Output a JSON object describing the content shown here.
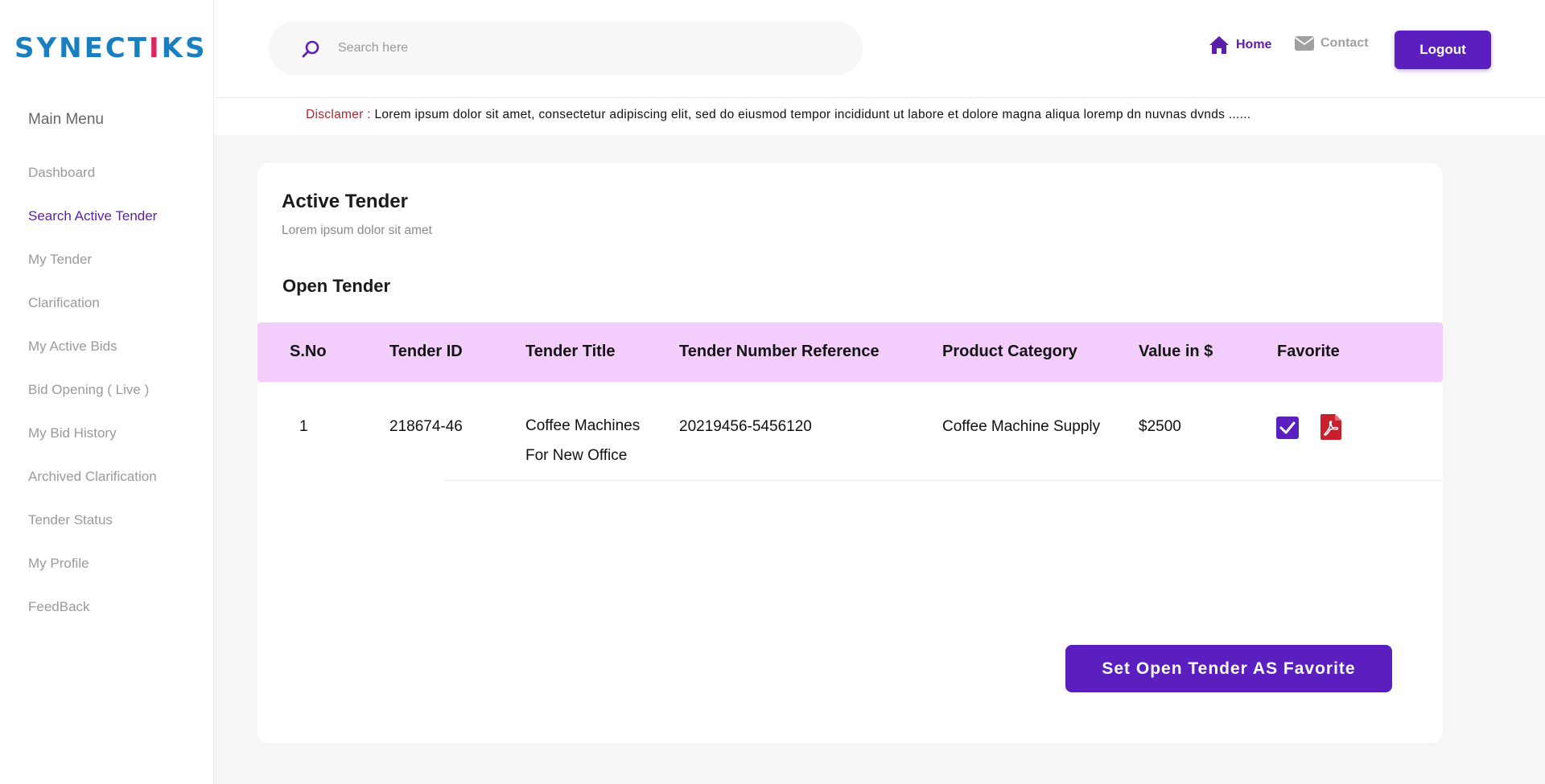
{
  "brand": {
    "logo_text_start": "SYNECT",
    "logo_text_i": "I",
    "logo_text_end": "KS"
  },
  "sidebar": {
    "title": "Main Menu",
    "items": [
      {
        "label": "Dashboard",
        "active": false
      },
      {
        "label": "Search Active Tender",
        "active": true
      },
      {
        "label": "My Tender",
        "active": false
      },
      {
        "label": "Clarification",
        "active": false
      },
      {
        "label": "My Active Bids",
        "active": false
      },
      {
        "label": "Bid Opening ( Live )",
        "active": false
      },
      {
        "label": "My Bid History",
        "active": false
      },
      {
        "label": "Archived Clarification",
        "active": false
      },
      {
        "label": "Tender Status",
        "active": false
      },
      {
        "label": "My Profile",
        "active": false
      },
      {
        "label": "FeedBack",
        "active": false
      }
    ]
  },
  "topbar": {
    "search_placeholder": "Search here",
    "home_label": "Home",
    "contact_label": "Contact",
    "logout_label": "Logout"
  },
  "disclaimer": {
    "label": "Disclamer",
    "separator": " : ",
    "text": "Lorem ipsum dolor sit amet, consectetur adipiscing elit, sed do eiusmod tempor incididunt ut labore et dolore magna aliqua loremp dn  nuvnas dvnds ......"
  },
  "card": {
    "title": "Active Tender",
    "subtitle": "Lorem ipsum dolor sit amet",
    "section_title": "Open Tender",
    "table": {
      "columns": [
        "S.No",
        "Tender ID",
        "Tender Title",
        "Tender Number Reference",
        "Product Category",
        "Value in $",
        "Favorite"
      ],
      "rows": [
        {
          "sno": "1",
          "tender_id": "218674-46",
          "title": "Coffee Machines For New Office",
          "reference": "20219456-5456120",
          "category": "Coffee Machine Supply",
          "value": "$2500",
          "favorite": true
        }
      ]
    },
    "primary_button": "Set Open Tender AS Favorite"
  },
  "colors": {
    "accent": "#5b1fc0",
    "header_row": "#f3cdfb",
    "logo_blue": "#1a7fc1",
    "logo_pink": "#e0245e",
    "disclaimer_red": "#b3262e",
    "pdf_red": "#c8202f"
  },
  "icons": {
    "search": "search-icon",
    "home": "home-icon",
    "contact": "envelope-icon",
    "favorite": "checkbox-checked-icon",
    "pdf": "pdf-icon"
  }
}
